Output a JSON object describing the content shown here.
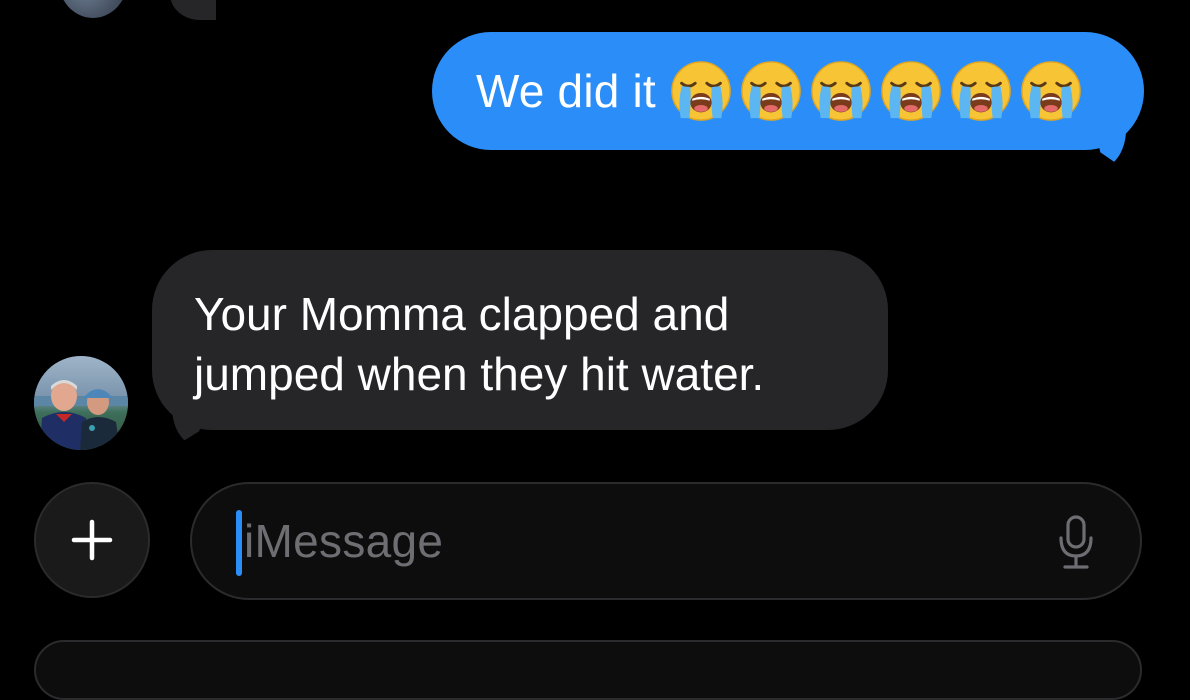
{
  "conversation": {
    "messages": [
      {
        "direction": "outgoing",
        "text": "We did it",
        "emoji": [
          "loudly-crying-face",
          "loudly-crying-face",
          "loudly-crying-face",
          "loudly-crying-face",
          "loudly-crying-face",
          "loudly-crying-face"
        ]
      },
      {
        "direction": "incoming",
        "lines": [
          "Your Momma clapped and",
          "jumped when they hit water."
        ]
      }
    ]
  },
  "compose": {
    "placeholder": "iMessage",
    "plus_icon": "plus-icon",
    "mic_icon": "microphone-icon"
  },
  "colors": {
    "background": "#000000",
    "outgoing_bubble": "#2b8ef8",
    "incoming_bubble": "#262628",
    "caret": "#2b8ef8",
    "placeholder": "#6d6d72"
  }
}
